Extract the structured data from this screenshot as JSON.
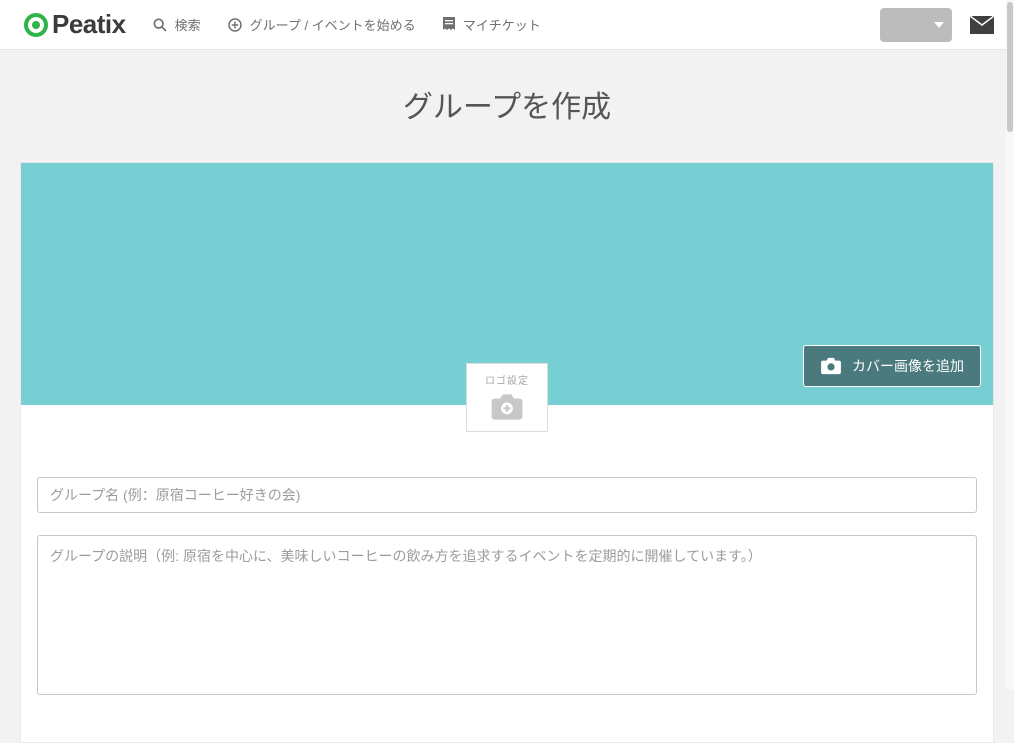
{
  "brand": {
    "name": "Peatix"
  },
  "nav": {
    "search": "検索",
    "start": "グループ / イベントを始める",
    "tickets": "マイチケット"
  },
  "page": {
    "title": "グループを作成"
  },
  "cover": {
    "add_label": "カバー画像を追加"
  },
  "logo_setter": {
    "label": "ロゴ設定"
  },
  "form": {
    "name_placeholder": "グループ名 (例：原宿コーヒー好きの会)",
    "description_placeholder": "グループの説明（例: 原宿を中心に、美味しいコーヒーの飲み方を追求するイベントを定期的に開催しています。）"
  }
}
